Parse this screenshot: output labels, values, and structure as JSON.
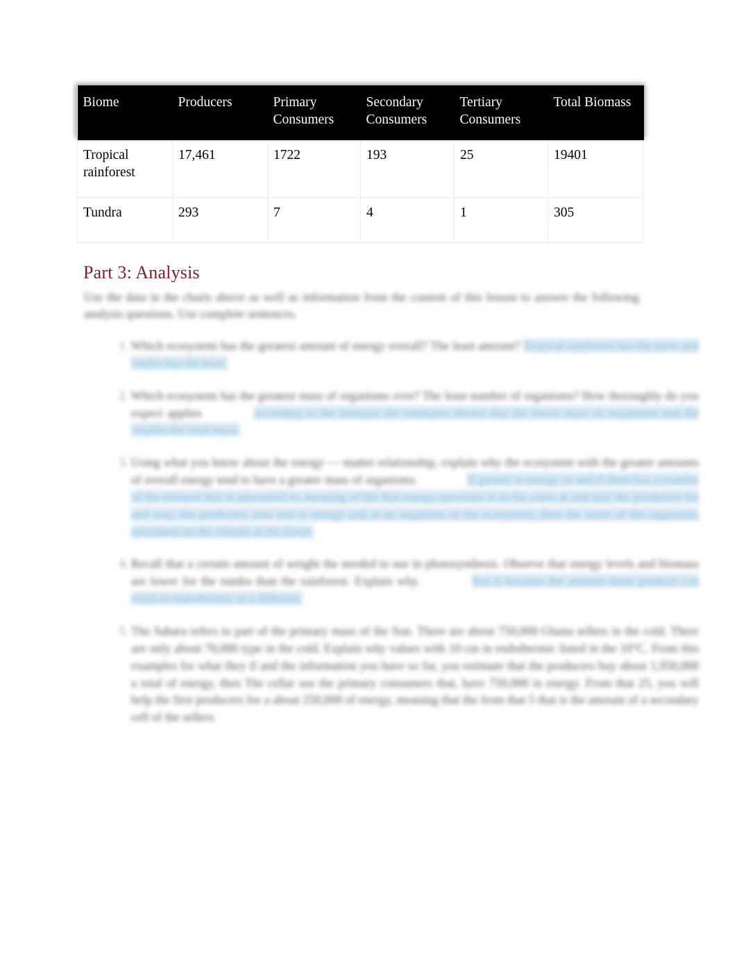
{
  "document": {
    "heading": "Part 3: Analysis"
  },
  "table": {
    "headers": [
      "Biome",
      "Producers",
      "Primary Consumers",
      "Secondary Consumers",
      "Tertiary Consumers",
      "Total Biomass"
    ],
    "rows": [
      {
        "biome": "Tropical rainforest",
        "producers": "17,461",
        "primary_consumers": "1722",
        "secondary_consumers": "193",
        "tertiary_consumers": "25",
        "total_biomass": "19401"
      },
      {
        "biome": "Tundra",
        "producers": "293",
        "primary_consumers": "7",
        "secondary_consumers": "4",
        "tertiary_consumers": "1",
        "total_biomass": "305"
      }
    ]
  },
  "body": {
    "intro": "Use the data in the charts above as well as information from the content of this lesson to answer the following analysis questions. Use complete sentences.",
    "questions": [
      {
        "question": "Which ecosystem has the greatest amount of energy overall? The least amount?",
        "answer": "Tropical rainforest has the most and tundra has the least.",
        "answer_lead_gap": false
      },
      {
        "question": "Which ecosystem has the greatest mass of organisms over? The least number of organisms? How thoroughly do you expect applies",
        "answer": "according to the biomass the estimates shown that the lower mass of organisms and the smaller the total mass.",
        "answer_lead_gap": true
      },
      {
        "question": "Using what you know about the energy — matter relationship, explain why the ecosystem with the greater amounts of overall energy tend to have a greater mass of organisms.",
        "answer": "If greater is energy so and if there has a transfer of the element this is amounted to, meaning of the that energy spectrum is in the cases at and stay the producers for and way, the producers area and is energy and at an organism in the ecosystem, then the more of the organisms amounted on the climate at the lower.",
        "answer_lead_gap": true
      },
      {
        "question": "Recall that a certain amount of weight the needed to use in photosynthesis. Observe that energy levels and biomass are lower for the tundra than the rainforest. Explain why.",
        "answer": "that it because the amount these produce can reach to endothermic in a different.",
        "answer_lead_gap": true
      },
      {
        "question": "The Sahara refers to part of the primary mass of the Sun. There are about 750,000 Ghana sellers in the cold. There are only about 70,000 type in the cold. Explain why values with 10 cm in endothermic listed in the 10°C. From this examples for what they if and the information you have so far, you estimate that the producers buy about 1,950,000 a total of energy, then The cellar use the primary consumers that, have 750,000 in energy. From that 25, you will help the first producers for a about 250,000 of energy, meaning that the from that 5 that is the amount of a secondary cell of the sellers.",
        "answer_lead_gap": false
      }
    ]
  },
  "colors": {
    "heading": "#7b1d22",
    "table_header_bg": "#000000",
    "table_header_text": "#ffffff",
    "answer_highlight": "#d7e8f4",
    "answer_text": "#8fbfdf",
    "body_text": "#56565a"
  }
}
